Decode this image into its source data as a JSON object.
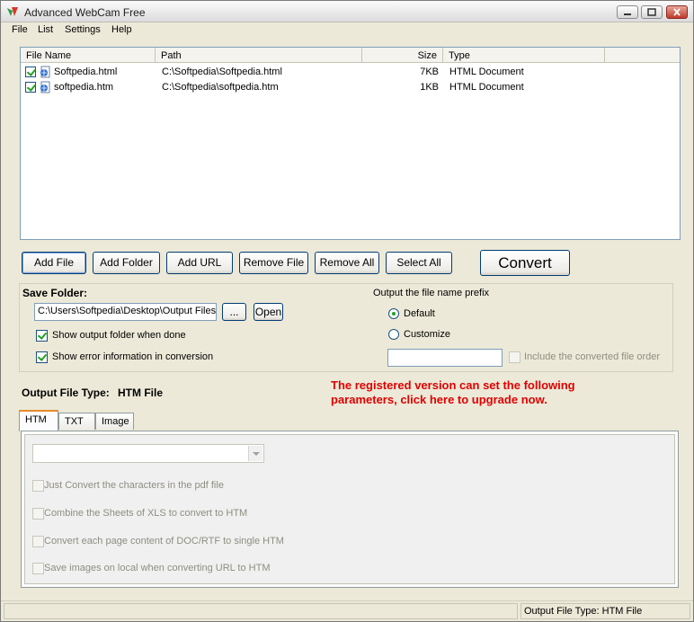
{
  "window": {
    "title": "Advanced WebCam Free"
  },
  "menu": [
    "File",
    "List",
    "Settings",
    "Help"
  ],
  "file_list": {
    "columns": [
      "File Name",
      "Path",
      "Size",
      "Type"
    ],
    "rows": [
      {
        "checked": true,
        "name": "Softpedia.html",
        "path": "C:\\Softpedia\\Softpedia.html",
        "size": "7KB",
        "type": "HTML Document"
      },
      {
        "checked": true,
        "name": "softpedia.htm",
        "path": "C:\\Softpedia\\softpedia.htm",
        "size": "1KB",
        "type": "HTML Document"
      }
    ]
  },
  "toolbar": {
    "add_file": "Add File",
    "add_folder": "Add Folder",
    "add_url": "Add URL",
    "remove_file": "Remove File",
    "remove_all": "Remove All",
    "select_all": "Select All",
    "convert": "Convert"
  },
  "save": {
    "label": "Save Folder:",
    "path": "C:\\Users\\Softpedia\\Desktop\\Output Files",
    "browse": "...",
    "open": "Open",
    "show_output": "Show output folder when done",
    "show_output_checked": true,
    "show_errors": "Show error information in conversion",
    "show_errors_checked": true
  },
  "prefix": {
    "label": "Output the file name prefix",
    "default": "Default",
    "customize": "Customize",
    "selected": "Default",
    "custom_value": "",
    "include_order": "Include the converted file order"
  },
  "output_type": {
    "label": "Output File Type:",
    "value": "HTM File"
  },
  "promo": {
    "line1": "The registered version can set the following",
    "line2": "parameters, click here to upgrade now."
  },
  "tabs": [
    "HTM",
    "TXT",
    "Image"
  ],
  "active_tab": "HTM",
  "htm_options": {
    "combo_value": "",
    "options": [
      "Just Convert the characters in the pdf file",
      "Combine the Sheets of XLS to convert to HTM",
      "Convert each page content of DOC/RTF to single HTM",
      "Save images on local when converting URL to HTM"
    ]
  },
  "status": {
    "left": "",
    "right": "Output File Type:  HTM File"
  },
  "colors": {
    "promo": "#e00000",
    "check": "#21a121",
    "tab_accent": "#e68b2c"
  }
}
